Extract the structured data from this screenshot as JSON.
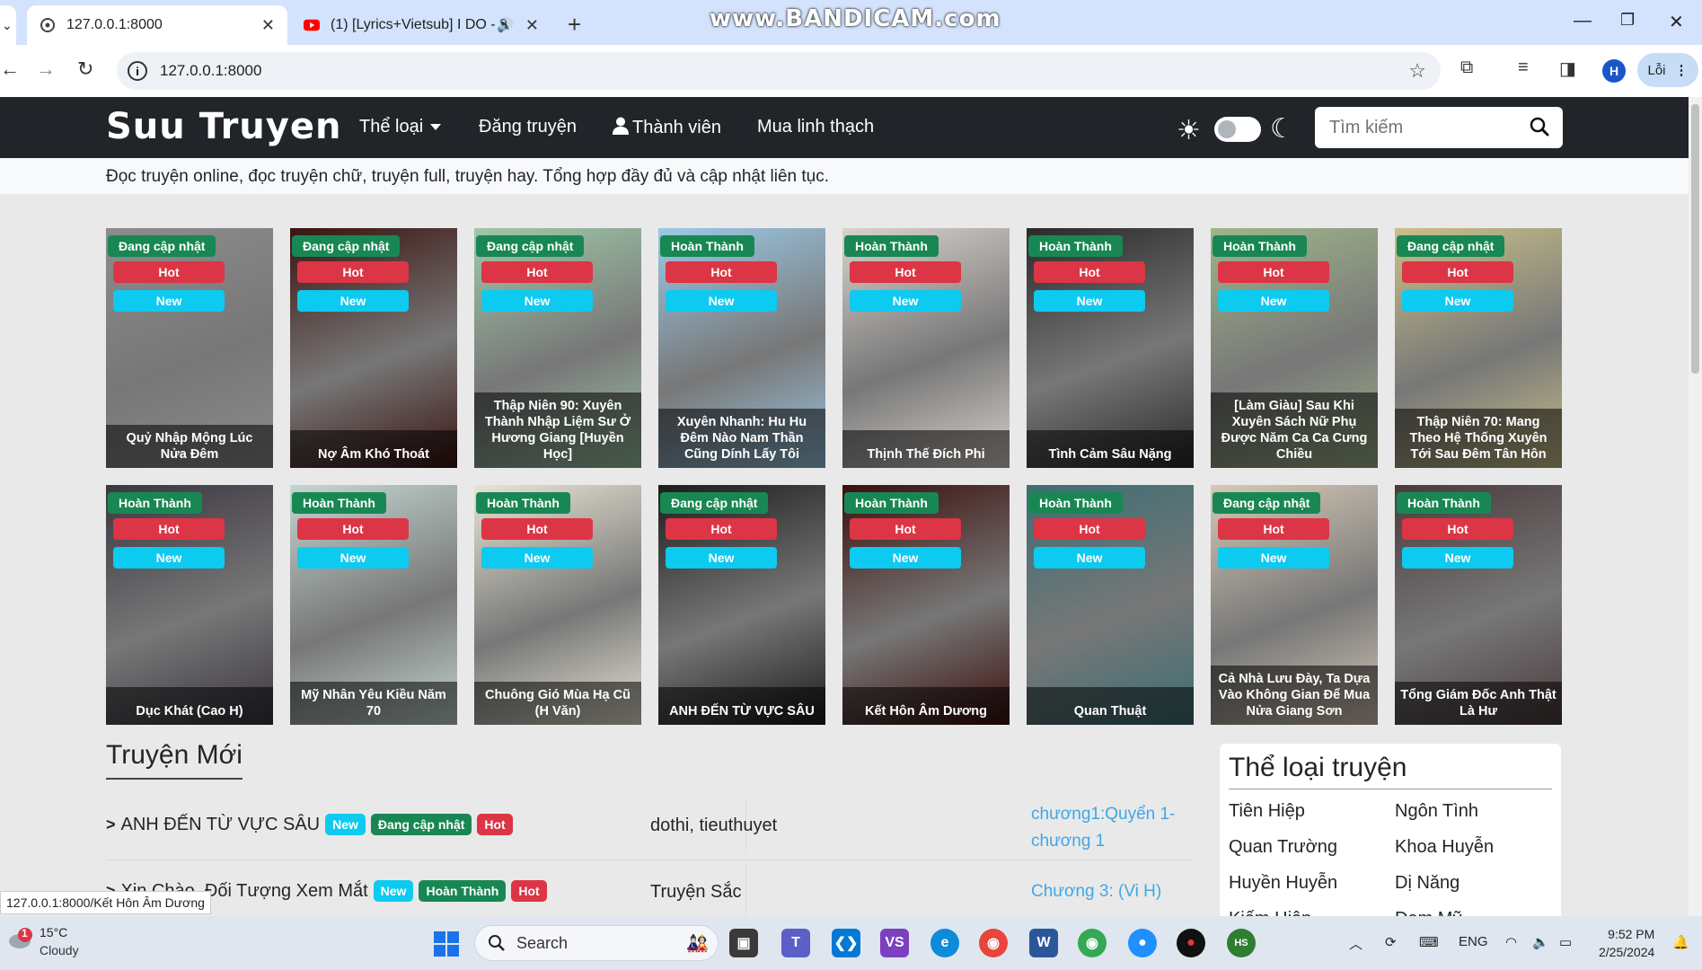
{
  "browser": {
    "tabs": [
      {
        "title": "127.0.0.1:8000",
        "active": true
      },
      {
        "title": "(1) [Lyrics+Vietsub] I DO - 9",
        "active": false
      }
    ],
    "new_tab": "+",
    "watermark": "www.BANDICAM.com",
    "url": "127.0.0.1:8000",
    "profile_initial": "H",
    "error_label": "Lỗi"
  },
  "site": {
    "brand": "Suu Truyen",
    "nav": {
      "genres": "Thể loại",
      "post_story": "Đăng truyện",
      "members": "Thành viên",
      "buy": "Mua linh thạch"
    },
    "search_placeholder": "Tìm kiếm",
    "tagline": "Đọc truyện online, đọc truyện chữ, truyện full, truyện hay. Tổng hợp đầy đủ và cập nhật liên tục."
  },
  "badges": {
    "hot": "Hot",
    "new": "New"
  },
  "cards": [
    {
      "status": "Đang cập nhật",
      "title": "Quỷ Nhập Mộng Lúc Nửa Đêm",
      "color": "#8c8c8c"
    },
    {
      "status": "Đang cập nhật",
      "title": "Nợ Âm Khó Thoát",
      "color": "#3a1410"
    },
    {
      "status": "Đang cập nhật",
      "title": "Thập Niên 90: Xuyên Thành Nhập Liệm Sư Ở Hương Giang [Huyền Học]",
      "color": "#9fc8a8"
    },
    {
      "status": "Hoàn Thành",
      "title": "Xuyên Nhanh: Hu Hu Đêm Nào Nam Thần Cũng Dính Lấy Tôi",
      "color": "#9cc9e6"
    },
    {
      "status": "Hoàn Thành",
      "title": "Thịnh Thế Đích Phi",
      "color": "#d8d2cc"
    },
    {
      "status": "Hoàn Thành",
      "title": "Tình Cảm Sâu Nặng",
      "color": "#2a2a2a"
    },
    {
      "status": "Hoàn Thành",
      "title": "[Làm Giàu] Sau Khi Xuyên Sách Nữ Phụ Được Năm Ca Ca Cưng Chiều",
      "color": "#9fb58a"
    },
    {
      "status": "Đang cập nhật",
      "title": "Thập Niên 70: Mang Theo Hệ Thống Xuyên Tới Sau Đêm Tân Hôn",
      "color": "#c9c08a"
    },
    {
      "status": "Hoàn Thành",
      "title": "Dục Khát (Cao H)",
      "color": "#3b3640"
    },
    {
      "status": "Hoàn Thành",
      "title": "Mỹ Nhân Yêu Kiều Năm 70",
      "color": "#c4d6d2"
    },
    {
      "status": "Hoàn Thành",
      "title": "Chuông Gió Mùa Hạ Cũ (H Văn)",
      "color": "#e8e4d4"
    },
    {
      "status": "Đang cập nhật",
      "title": "ANH ĐẾN TỪ VỰC SÂU",
      "color": "#1c1c1c"
    },
    {
      "status": "Hoàn Thành",
      "title": "Kết Hôn Âm Dương",
      "color": "#3a0f0c"
    },
    {
      "status": "Hoàn Thành",
      "title": "Quan Thuật",
      "color": "#3d6e74"
    },
    {
      "status": "Đang cập nhật",
      "title": "Cả Nhà Lưu Đày, Ta Dựa Vào Không Gian Để Mua Nửa Giang Sơn",
      "color": "#d5c9b6"
    },
    {
      "status": "Hoàn Thành",
      "title": "Tổng Giám Đốc Anh Thật Là Hư",
      "color": "#4a3b3c"
    }
  ],
  "new_stories": {
    "heading": "Truyện Mới",
    "rows": [
      {
        "title": "ANH ĐẾN TỪ VỰC SÂU",
        "badges": [
          "New",
          "Đang cập nhật",
          "Hot"
        ],
        "category": "dothi, tieuthuyet",
        "chapter": "chương1:Quyển 1-chương 1"
      },
      {
        "title": "Xin Chào, Đối Tượng Xem Mắt",
        "badges": [
          "New",
          "Hoàn Thành",
          "Hot"
        ],
        "category": "Truyện Sắc",
        "chapter": "Chương 3: (Vi H)"
      }
    ]
  },
  "genres": {
    "heading": "Thể loại truyện",
    "items": [
      "Tiên Hiệp",
      "Ngôn Tình",
      "Quan Trường",
      "Khoa Huyễn",
      "Huyền Huyễn",
      "Dị Năng",
      "Kiếm Hiệp",
      "Đam Mỹ"
    ]
  },
  "status_url": "127.0.0.1:8000/Kết Hôn Âm Dương",
  "taskbar": {
    "weather_temp": "15°C",
    "weather_cond": "Cloudy",
    "weather_alert": "1",
    "search_label": "Search",
    "lang": "ENG",
    "time": "9:52 PM",
    "date": "2/25/2024"
  }
}
